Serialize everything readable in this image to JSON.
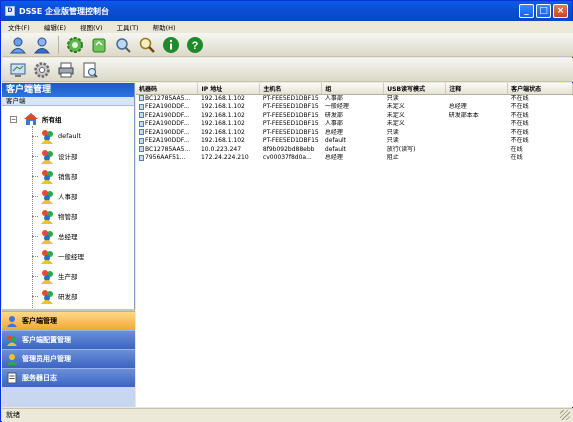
{
  "window": {
    "title": "DSSE 企业版管理控制台",
    "icon": "dsse-icon"
  },
  "titlebar_buttons": {
    "minimize": "_",
    "maximize": "□",
    "close": "×"
  },
  "menu": [
    "文件(F)",
    "编辑(E)",
    "视图(V)",
    "工具(T)",
    "帮助(H)"
  ],
  "toolbar1": [
    "user-icon",
    "user-alt-icon",
    "gear-green-icon",
    "recycle-icon",
    "gear-magnify-icon",
    "search-icon",
    "info-icon",
    "help-icon"
  ],
  "toolbar2": [
    "monitor-icon",
    "settings-icon",
    "printer-icon",
    "report-icon"
  ],
  "left": {
    "header": "客户端管理",
    "subheader": "客户端",
    "tree_root": "所有组",
    "tree_children": [
      "default",
      "设计部",
      "销售部",
      "人事部",
      "物管部",
      "总经理",
      "一般经理",
      "生产部",
      "研发部"
    ]
  },
  "nav": [
    {
      "label": "客户端管理",
      "icon": "client-mgmt-icon",
      "active": true
    },
    {
      "label": "客户端配置管理",
      "icon": "client-config-icon",
      "active": false
    },
    {
      "label": "管理员用户管理",
      "icon": "admin-users-icon",
      "active": false
    },
    {
      "label": "服务器日志",
      "icon": "server-log-icon",
      "active": false
    }
  ],
  "table": {
    "columns": [
      "机器码",
      "IP 地址",
      "主机名",
      "组",
      "USB读写模式",
      "注释",
      "客户端状态"
    ],
    "rows": [
      [
        "BC12785AA5...",
        "192.168.1.102",
        "PT-FEE5ED1DBF15",
        "人事部",
        "只读",
        "",
        "不在线"
      ],
      [
        "FE2A190DDF...",
        "192.168.1.102",
        "PT-FEE5ED1DBF15",
        "一般经理",
        "未定义",
        "总经理",
        "不在线"
      ],
      [
        "FE2A190DDF...",
        "192.168.1.102",
        "PT-FEE5ED1DBF15",
        "研发部",
        "未定义",
        "研发部本本",
        "不在线"
      ],
      [
        "FE2A190DDF...",
        "192.168.1.102",
        "PT-FEE5ED1DBF15",
        "人事部",
        "未定义",
        "",
        "不在线"
      ],
      [
        "FE2A190DDF...",
        "192.168.1.102",
        "PT-FEE5ED1DBF15",
        "总经理",
        "只读",
        "",
        "不在线"
      ],
      [
        "FE2A190DDF...",
        "192.168.1.102",
        "PT-FEE5ED1DBF15",
        "default",
        "只读",
        "",
        "不在线"
      ],
      [
        "BC12785AA5...",
        "10.0.223.247",
        "8f9b092bd88ebb",
        "default",
        "放行(读写)",
        "",
        "在线"
      ],
      [
        "7956AAF51...",
        "172.24.224.210",
        "cv00037f8d0a...",
        "总经理",
        "阻止",
        "",
        "在线"
      ]
    ]
  },
  "status": "就绪"
}
